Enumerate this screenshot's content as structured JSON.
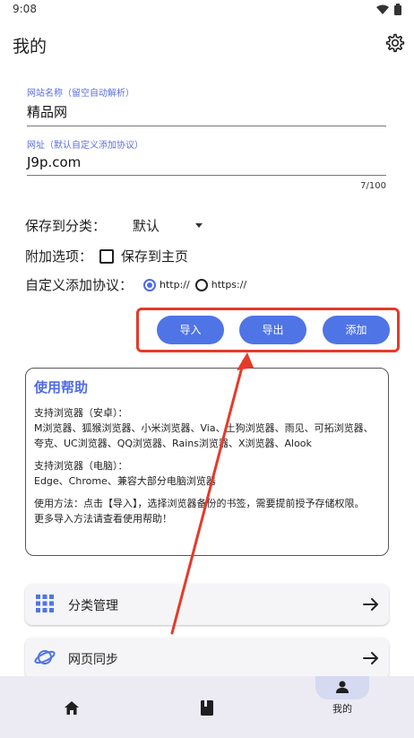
{
  "status": {
    "time": "9:08"
  },
  "header": {
    "title": "我的"
  },
  "form": {
    "name_label": "网站名称（留空自动解析）",
    "name_value": "精品网",
    "url_label": "网址（默认自定义添加协议）",
    "url_value": "J9p.com",
    "counter": "7/100",
    "save_label": "保存到分类：",
    "save_value": "默认",
    "extra_label": "附加选项：",
    "extra_option": "保存到主页",
    "protocol_label": "自定义添加协议：",
    "protocol_http": "http://",
    "protocol_https": "https://"
  },
  "actions": {
    "import": "导入",
    "export": "导出",
    "add": "添加"
  },
  "help": {
    "title": "使用帮助",
    "android_title": "支持浏览器（安卓）：",
    "android_list": "M浏览器、狐猴浏览器、小米浏览器、Via、土狗浏览器、雨见、可拓浏览器、夸克、UC浏览器、QQ浏览器、Rains浏览器、X浏览器、Alook",
    "pc_title": "支持浏览器（电脑）：",
    "pc_list": "Edge、Chrome、兼容大部分电脑浏览器",
    "usage": "使用方法：点击【导入】，选择浏览器备份的书签，需要提前授予存储权限。",
    "more": "更多导入方法请查看使用帮助！"
  },
  "menu": {
    "category": "分类管理",
    "sync": "网页同步"
  },
  "nav": {
    "mine": "我的"
  },
  "colors": {
    "accent": "#4f74e6",
    "annotation": "#e53a2a"
  }
}
